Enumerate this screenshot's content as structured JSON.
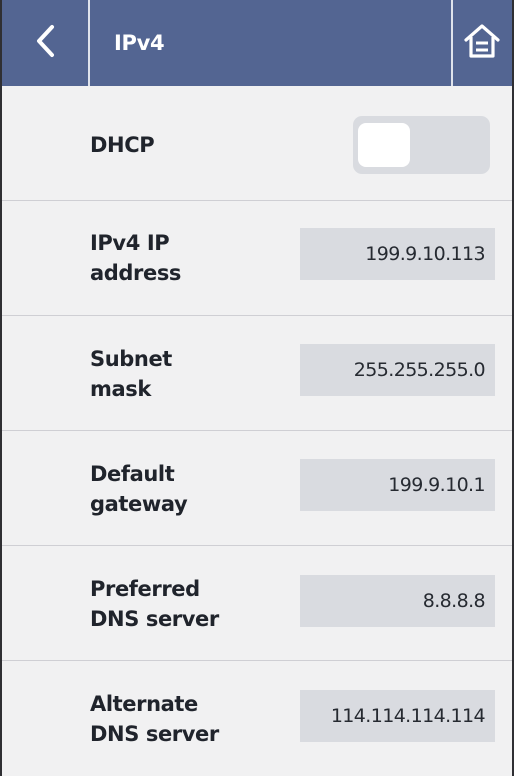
{
  "header": {
    "title": "IPv4",
    "back_icon": "chevron-left-icon",
    "home_icon": "home-icon"
  },
  "dhcp": {
    "label": "DHCP",
    "enabled": false
  },
  "fields": [
    {
      "label": "IPv4 IP\naddress",
      "value": "199.9.10.113"
    },
    {
      "label": "Subnet\nmask",
      "value": "255.255.255.0"
    },
    {
      "label": "Default\ngateway",
      "value": "199.9.10.1"
    },
    {
      "label": "Preferred\nDNS server",
      "value": "8.8.8.8"
    },
    {
      "label": "Alternate\nDNS server",
      "value": "114.114.114.114"
    }
  ],
  "colors": {
    "header_bg": "#536592",
    "body_bg": "#f1f1f2",
    "field_bg": "#d9dbe0",
    "text": "#20242c"
  }
}
